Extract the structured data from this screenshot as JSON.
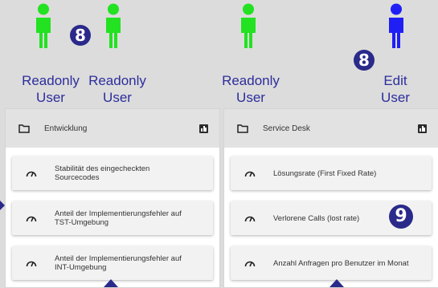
{
  "users": [
    {
      "role": "readonly",
      "line1": "Readonly",
      "line2": "User"
    },
    {
      "role": "readonly",
      "line1": "Readonly",
      "line2": "User"
    },
    {
      "role": "readonly",
      "line1": "Readonly",
      "line2": "User"
    },
    {
      "role": "edit",
      "line1": "Edit",
      "line2": "User"
    }
  ],
  "badges": {
    "users": "8",
    "edit_user": "8",
    "card": "9"
  },
  "colors": {
    "readonly_user": "#22e222",
    "edit_user": "#1f1ff5",
    "badge": "#2a2a8a",
    "label": "#2d2d9c"
  },
  "panels": [
    {
      "title": "Entwicklung",
      "folder_icon": "folder-icon",
      "chart_icon": "bar-chart-icon",
      "cards": [
        {
          "label": "Stabilität des eingecheckten\nSourcecodes",
          "icon": "gauge-icon"
        },
        {
          "label": "Anteil der Implementierungsfehler auf\nTST-Umgebung",
          "icon": "gauge-icon"
        },
        {
          "label": "Anteil der Implementierungsfehler auf\nINT-Umgebung",
          "icon": "gauge-icon"
        }
      ]
    },
    {
      "title": "Service Desk",
      "folder_icon": "folder-icon",
      "chart_icon": "bar-chart-icon",
      "cards": [
        {
          "label": "Lösungsrate (First Fixed Rate)",
          "icon": "gauge-icon"
        },
        {
          "label": "Verlorene Calls (lost rate)",
          "icon": "gauge-icon"
        },
        {
          "label": "Anzahl Anfragen pro Benutzer im Monat",
          "icon": "gauge-icon"
        }
      ]
    }
  ]
}
